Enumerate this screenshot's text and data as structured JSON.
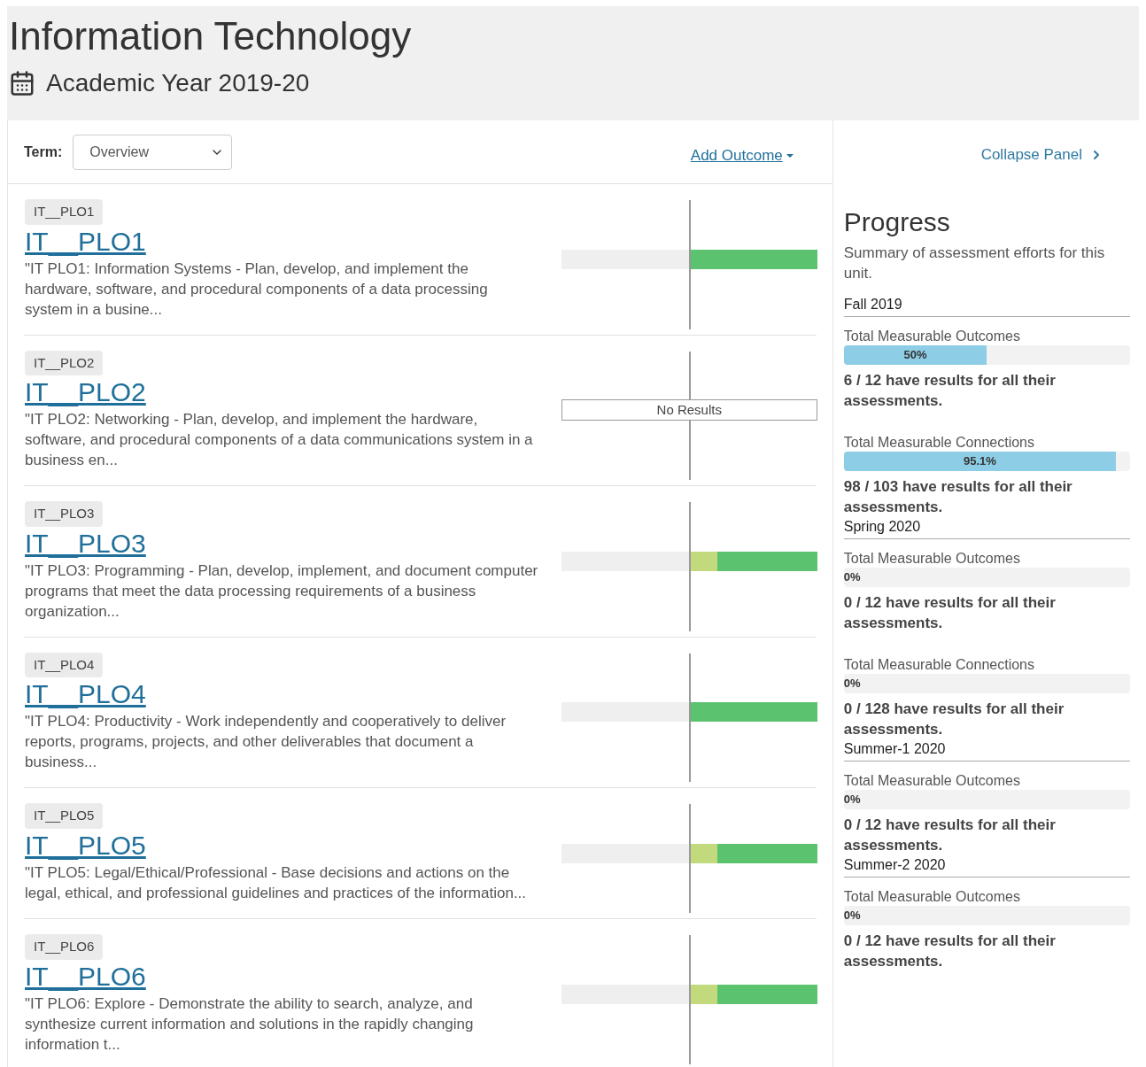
{
  "header": {
    "title": "Information Technology",
    "academic_year": "Academic Year 2019-20"
  },
  "toolbar": {
    "term_label": "Term:",
    "term_value": "Overview",
    "add_outcome": "Add Outcome"
  },
  "outcomes": [
    {
      "tag": "IT__PLO1",
      "title": "IT__PLO1",
      "description": "\"IT PLO1: Information Systems - Plan, develop, and implement the hardware, software, and procedural components of a data processing system in a busine...",
      "bar": {
        "kind": "results",
        "segments": [
          {
            "level": 1,
            "color": "#5bc26f"
          }
        ]
      }
    },
    {
      "tag": "IT__PLO2",
      "title": "IT__PLO2",
      "description": "\"IT PLO2: Networking - Plan, develop, and implement the hardware, software, and procedural components of a data communications system in a business en...",
      "bar": {
        "kind": "none",
        "text": "No Results"
      }
    },
    {
      "tag": "IT__PLO3",
      "title": "IT__PLO3",
      "description": "\"IT PLO3: Programming - Plan, develop, implement, and document computer programs that meet the data processing requirements of a business organization...",
      "bar": {
        "kind": "results",
        "segments": [
          {
            "level": 0.22,
            "color": "#c3da7c"
          },
          {
            "level": 0.78,
            "color": "#5bc26f"
          }
        ]
      }
    },
    {
      "tag": "IT__PLO4",
      "title": "IT__PLO4",
      "description": "\"IT PLO4: Productivity - Work independently and cooperatively to deliver reports, programs, projects, and other deliverables that document a business...",
      "bar": {
        "kind": "results",
        "segments": [
          {
            "level": 1,
            "color": "#5bc26f"
          }
        ]
      }
    },
    {
      "tag": "IT__PLO5",
      "title": "IT__PLO5",
      "description": "\"IT PLO5: Legal/Ethical/Professional - Base decisions and actions on the legal, ethical, and professional guidelines and practices of the information...",
      "bar": {
        "kind": "results",
        "segments": [
          {
            "level": 0.22,
            "color": "#c3da7c"
          },
          {
            "level": 0.78,
            "color": "#5bc26f"
          }
        ]
      }
    },
    {
      "tag": "IT__PLO6",
      "title": "IT__PLO6",
      "description": "\"IT PLO6: Explore - Demonstrate the ability to search, analyze, and synthesize current information and solutions in the rapidly changing information t...",
      "bar": {
        "kind": "results",
        "segments": [
          {
            "level": 0.22,
            "color": "#c3da7c"
          },
          {
            "level": 0.78,
            "color": "#5bc26f"
          }
        ]
      }
    }
  ],
  "progress_panel": {
    "collapse": "Collapse Panel",
    "title": "Progress",
    "summary": "Summary of assessment efforts for this unit.",
    "terms": [
      {
        "name": "Fall 2019",
        "metrics": [
          {
            "label": "Total Measurable Outcomes",
            "level": 0.5,
            "reading": "50%",
            "note": "6 / 12 have results for all their assessments."
          },
          {
            "label": "Total Measurable Connections",
            "level": 0.951,
            "reading": "95.1%",
            "note": "98 / 103 have results for all their assessments."
          }
        ]
      },
      {
        "name": "Spring 2020",
        "metrics": [
          {
            "label": "Total Measurable Outcomes",
            "level": 0,
            "reading": "0%",
            "note": "0 / 12 have results for all their assessments."
          },
          {
            "label": "Total Measurable Connections",
            "level": 0,
            "reading": "0%",
            "note": "0 / 128 have results for all their assessments."
          }
        ]
      },
      {
        "name": "Summer-1 2020",
        "metrics": [
          {
            "label": "Total Measurable Outcomes",
            "level": 0,
            "reading": "0%",
            "note": "0 / 12 have results for all their assessments."
          }
        ]
      },
      {
        "name": "Summer-2 2020",
        "metrics": [
          {
            "label": "Total Measurable Outcomes",
            "level": 0,
            "reading": "0%",
            "note": "0 / 12 have results for all their assessments."
          }
        ]
      }
    ]
  }
}
